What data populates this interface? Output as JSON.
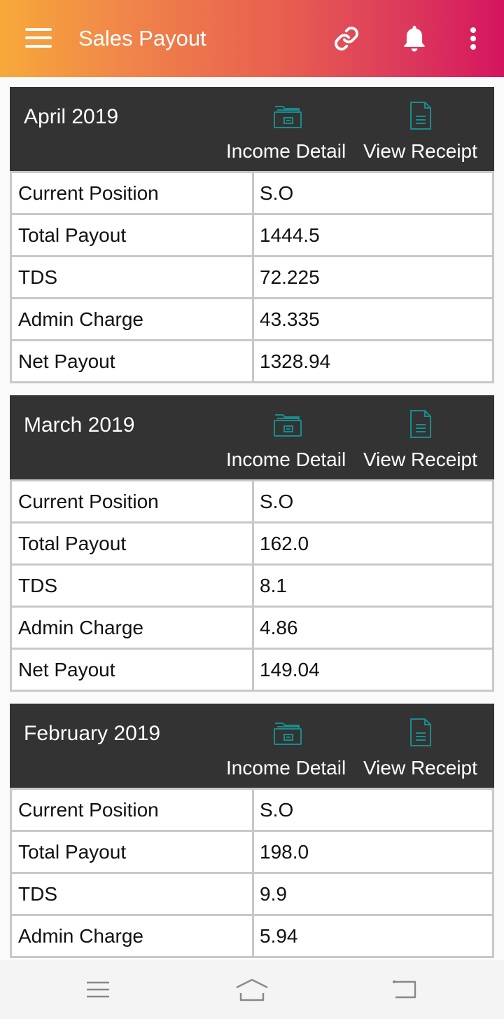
{
  "app": {
    "title": "Sales Payout"
  },
  "header": {
    "icons": [
      "menu-icon",
      "link-icon",
      "bell-icon",
      "more-vertical-icon"
    ]
  },
  "actions": {
    "income_detail": "Income Detail",
    "view_receipt": "View Receipt"
  },
  "cards": [
    {
      "month": "April 2019",
      "rows": [
        {
          "label": "Current Position",
          "value": "S.O"
        },
        {
          "label": "Total Payout",
          "value": "1444.5"
        },
        {
          "label": "TDS",
          "value": "72.225"
        },
        {
          "label": "Admin Charge",
          "value": "43.335"
        },
        {
          "label": "Net Payout",
          "value": "1328.94"
        }
      ]
    },
    {
      "month": "March 2019",
      "rows": [
        {
          "label": "Current Position",
          "value": "S.O"
        },
        {
          "label": "Total Payout",
          "value": "162.0"
        },
        {
          "label": "TDS",
          "value": "8.1"
        },
        {
          "label": "Admin Charge",
          "value": "4.86"
        },
        {
          "label": "Net Payout",
          "value": "149.04"
        }
      ]
    },
    {
      "month": "February 2019",
      "rows": [
        {
          "label": "Current Position",
          "value": "S.O"
        },
        {
          "label": "Total Payout",
          "value": "198.0"
        },
        {
          "label": "TDS",
          "value": "9.9"
        },
        {
          "label": "Admin Charge",
          "value": "5.94"
        }
      ]
    }
  ],
  "colors": {
    "gradient_start": "#f7a93a",
    "gradient_end": "#d4155e",
    "card_header": "#333333",
    "icon_teal": "#1a8c8c",
    "border": "#c8c8c8"
  }
}
